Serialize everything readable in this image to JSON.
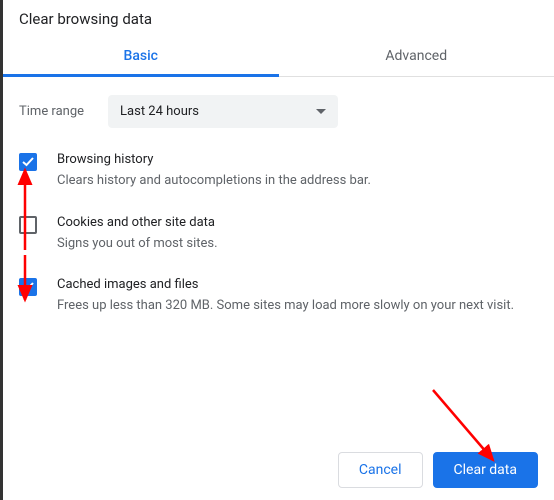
{
  "title": "Clear browsing data",
  "tabs": {
    "basic": "Basic",
    "advanced": "Advanced"
  },
  "time": {
    "label": "Time range",
    "value": "Last 24 hours"
  },
  "options": [
    {
      "title": "Browsing history",
      "desc": "Clears history and autocompletions in the address bar.",
      "checked": true
    },
    {
      "title": "Cookies and other site data",
      "desc": "Signs you out of most sites.",
      "checked": false
    },
    {
      "title": "Cached images and files",
      "desc": "Frees up less than 320 MB. Some sites may load more slowly on your next visit.",
      "checked": true
    }
  ],
  "buttons": {
    "cancel": "Cancel",
    "clear": "Clear data"
  },
  "colors": {
    "accent": "#1a73e8",
    "annotation": "#ff0000"
  }
}
